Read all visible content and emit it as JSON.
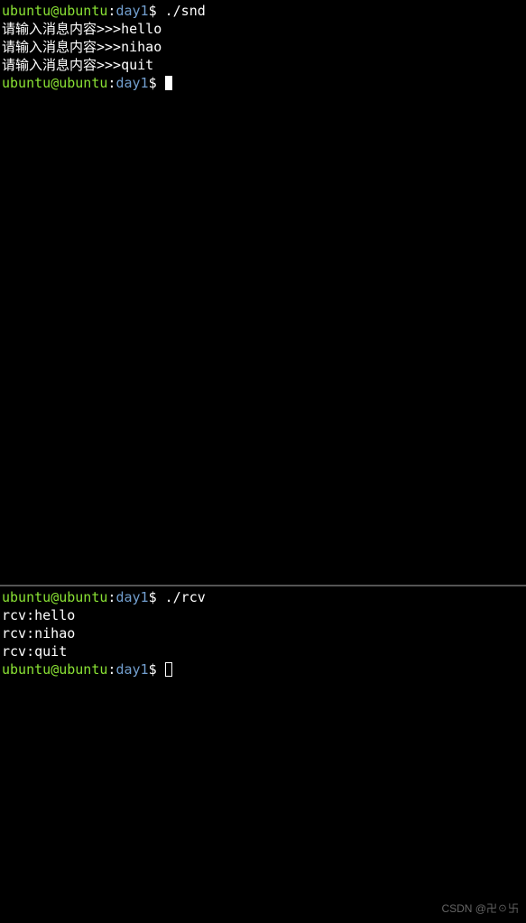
{
  "top_pane": {
    "prompt1": {
      "user": "ubuntu",
      "at": "@",
      "host": "ubuntu",
      "colon": ":",
      "path": "day1",
      "dollar": "$ ",
      "command": "./snd"
    },
    "lines": [
      "请输入消息内容>>>hello",
      "请输入消息内容>>>nihao",
      "请输入消息内容>>>quit"
    ],
    "prompt2": {
      "user": "ubuntu",
      "at": "@",
      "host": "ubuntu",
      "colon": ":",
      "path": "day1",
      "dollar": "$ "
    }
  },
  "bottom_pane": {
    "prompt1": {
      "user": "ubuntu",
      "at": "@",
      "host": "ubuntu",
      "colon": ":",
      "path": "day1",
      "dollar": "$ ",
      "command": "./rcv"
    },
    "lines": [
      "rcv:hello",
      "rcv:nihao",
      "rcv:quit"
    ],
    "prompt2": {
      "user": "ubuntu",
      "at": "@",
      "host": "ubuntu",
      "colon": ":",
      "path": "day1",
      "dollar": "$ "
    }
  },
  "watermark": "CSDN @卍☉卐"
}
